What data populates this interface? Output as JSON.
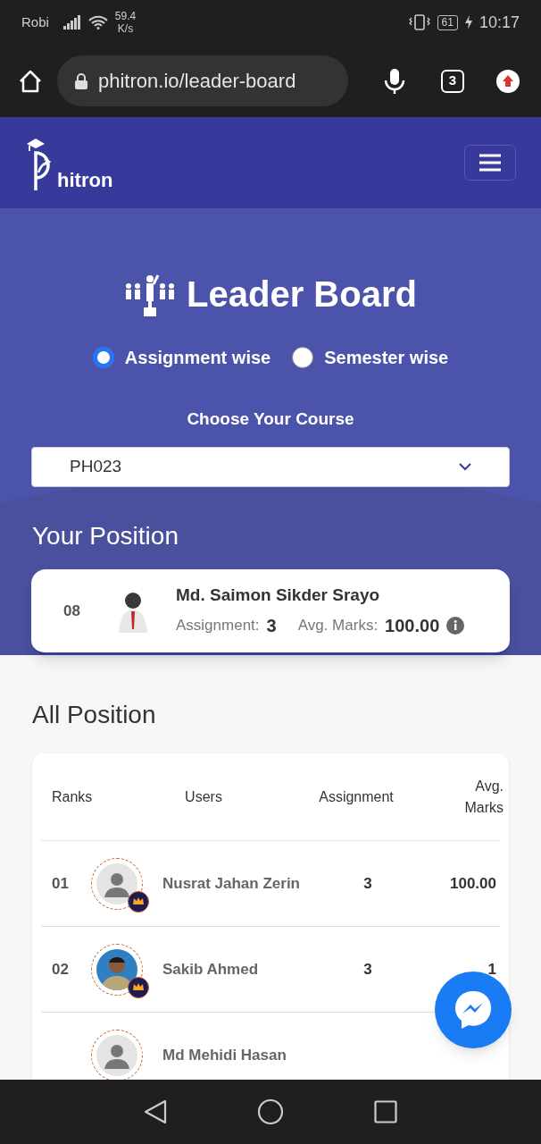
{
  "status_bar": {
    "carrier": "Robi",
    "speed_value": "59.4",
    "speed_unit": "K/s",
    "battery": "61",
    "time": "10:17"
  },
  "browser": {
    "url": "phitron.io/leader-board",
    "tab_count": "3"
  },
  "navbar": {
    "logo_text": "hitron"
  },
  "hero": {
    "title": "Leader Board",
    "modes": [
      {
        "label": "Assignment wise",
        "selected": true
      },
      {
        "label": "Semester wise",
        "selected": false
      }
    ],
    "course_label": "Choose Your Course",
    "course_value": "PH023"
  },
  "your_position": {
    "heading": "Your Position",
    "rank": "08",
    "name": "Md. Saimon Sikder Srayo",
    "assignment_label": "Assignment:",
    "assignment": "3",
    "avg_label": "Avg. Marks:",
    "avg": "100.00"
  },
  "all_position": {
    "heading": "All Position",
    "columns": [
      "Ranks",
      "Users",
      "Assignment",
      "Avg. Marks"
    ],
    "rows": [
      {
        "rank": "01",
        "kind": "placeholder",
        "crown": true,
        "name": "Nusrat Jahan Zerin",
        "assignment": "3",
        "avg": "100.00"
      },
      {
        "rank": "02",
        "crown": true,
        "name": "Sakib Ahmed",
        "assignment": "3",
        "avg": "1"
      },
      {
        "kind": "placeholder",
        "crown": false,
        "name": "Md Mehidi Hasan"
      }
    ]
  }
}
